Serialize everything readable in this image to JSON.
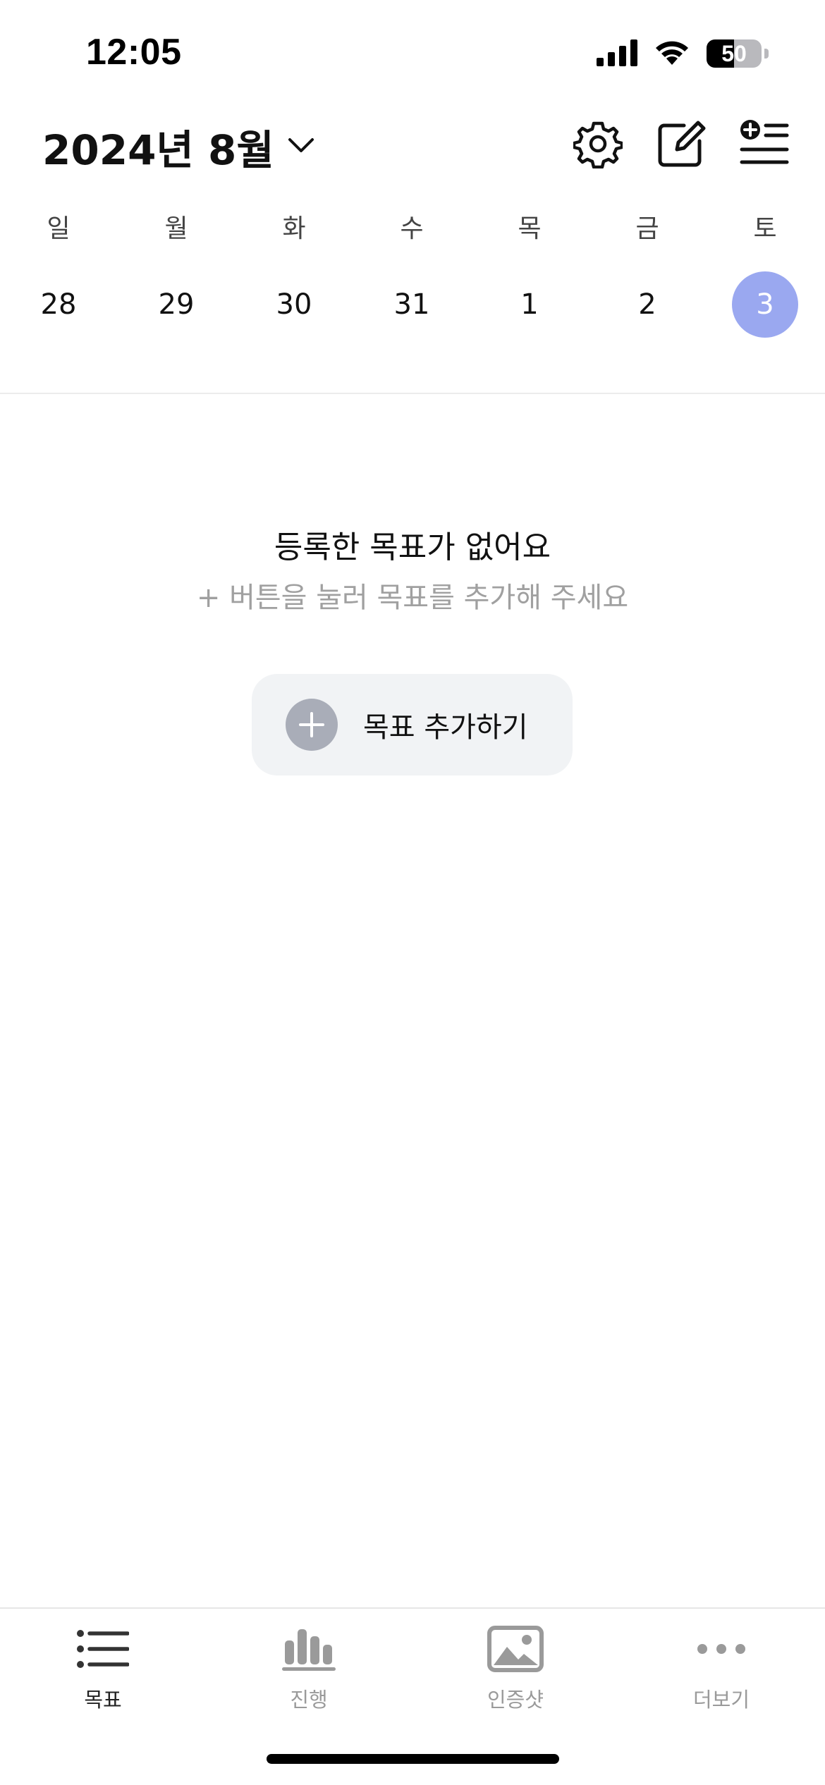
{
  "status_bar": {
    "time": "12:05",
    "battery_level": "50",
    "icons": [
      "signal-icon",
      "wifi-icon",
      "battery-icon"
    ]
  },
  "header": {
    "month_label": "2024년 8월",
    "icons": [
      "chevron-down-icon",
      "gear-icon",
      "edit-icon",
      "add-list-icon"
    ]
  },
  "week": {
    "weekdays": [
      "일",
      "월",
      "화",
      "수",
      "목",
      "금",
      "토"
    ],
    "dates": [
      "28",
      "29",
      "30",
      "31",
      "1",
      "2",
      "3"
    ],
    "selected_date": "3",
    "accent_color": "#9aa8f0"
  },
  "empty_state": {
    "title": "등록한 목표가 없어요",
    "subtitle": "+ 버튼을 눌러 목표를 추가해 주세요",
    "add_button_label": "목표 추가하기"
  },
  "tabbar": {
    "tabs": [
      {
        "label": "목표",
        "icon": "list-icon",
        "active": true
      },
      {
        "label": "진행",
        "icon": "bar-chart-icon",
        "active": false
      },
      {
        "label": "인증샷",
        "icon": "image-icon",
        "active": false
      },
      {
        "label": "더보기",
        "icon": "more-icon",
        "active": false
      }
    ]
  }
}
